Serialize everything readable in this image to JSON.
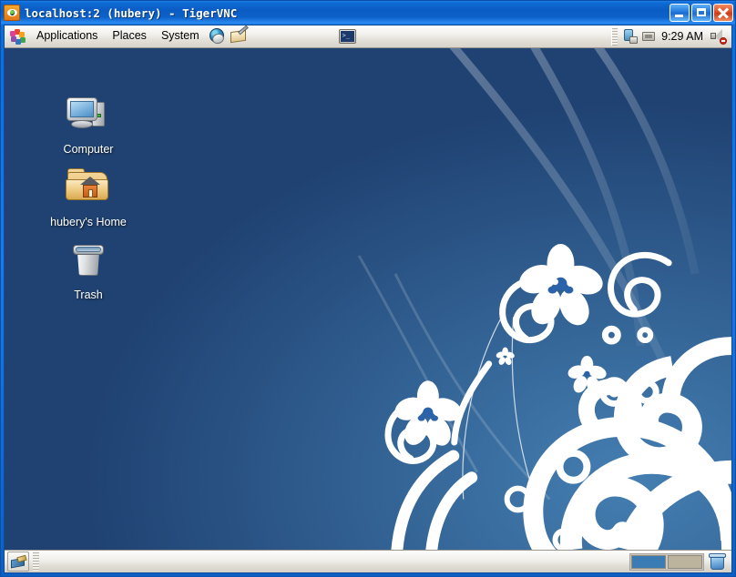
{
  "window": {
    "title": "localhost:2 (hubery) - TigerVNC",
    "icon": "tigervnc-eye-icon",
    "controls": {
      "minimize": "Minimize",
      "maximize": "Maximize",
      "close": "Close"
    }
  },
  "top_panel": {
    "logo": "gnome-foot-icon",
    "menus": [
      {
        "label": "Applications",
        "name": "applications-menu"
      },
      {
        "label": "Places",
        "name": "places-menu"
      },
      {
        "label": "System",
        "name": "system-menu"
      }
    ],
    "launchers": [
      {
        "name": "web-browser-icon",
        "title": "Web Browser"
      },
      {
        "name": "email-client-icon",
        "title": "Email"
      },
      {
        "name": "terminal-icon",
        "title": "Terminal",
        "prompt": ">_"
      }
    ],
    "tray": {
      "battery": "battery-power-icon",
      "applet": "display-applet-icon",
      "clock": "9:29 AM",
      "volume": "volume-muted-icon"
    }
  },
  "desktop": {
    "wallpaper": {
      "name": "floral-swirl-wallpaper",
      "bg_top_left": "#1f4272",
      "bg_bottom_right": "#2e74c0",
      "motif_color": "#ffffff"
    },
    "icons": [
      {
        "label": "Computer",
        "name": "desktop-icon-computer",
        "glyph": "computer-icon"
      },
      {
        "label": "hubery's Home",
        "name": "desktop-icon-home",
        "glyph": "home-folder-icon"
      },
      {
        "label": "Trash",
        "name": "desktop-icon-trash",
        "glyph": "trash-icon"
      }
    ]
  },
  "bottom_panel": {
    "show_desktop": "show-desktop-button",
    "window_list": [],
    "workspaces": [
      {
        "name": "workspace-1",
        "state": "active"
      },
      {
        "name": "workspace-2",
        "state": "inactive"
      }
    ],
    "trash_applet": "trash-applet-icon"
  }
}
